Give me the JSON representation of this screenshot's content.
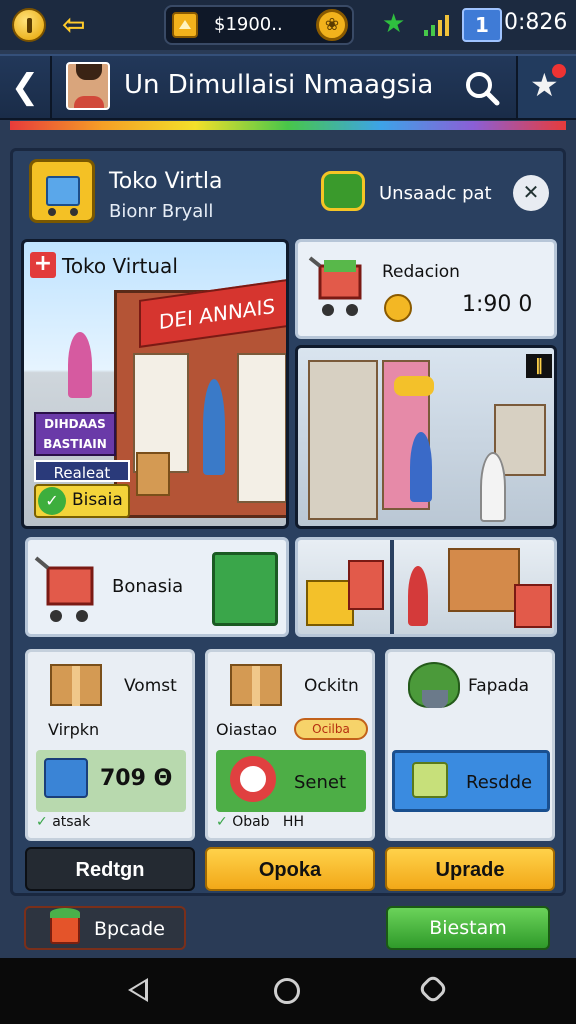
{
  "status_bar": {
    "money": "$1900..",
    "time": "0:826",
    "battery_glyph": "1"
  },
  "header": {
    "title": "Un Dimullaisi Nmaagsia"
  },
  "shop": {
    "title": "Toko Virtla",
    "subtitle": "Bionr Bryall",
    "ticket_label": "Unsaadc pat"
  },
  "scene_main": {
    "title": "Toko Virtual",
    "store_sign": "DEI ANNAIS",
    "promo_sign": "DIHDAAS BASTIAIN",
    "release_tag": "Realeat",
    "badge_label": "Bisaia"
  },
  "redacion_card": {
    "label": "Redacion",
    "price": "1:90 0"
  },
  "bonasia_card": {
    "label": "Bonasia"
  },
  "products": [
    {
      "name": "Vomst",
      "sub": "Virpkn",
      "price": "709 Θ",
      "status": "atsak",
      "button": "Redtgn"
    },
    {
      "name": "Ockitn",
      "sub": "Oiastao",
      "pill": "Ocilba",
      "panel_label": "Senet",
      "status": "Obab",
      "status_extra": "HH",
      "button": "Opoka"
    },
    {
      "name": "Fapada",
      "panel_label": "Resdde",
      "button": "Uprade"
    }
  ],
  "footer": {
    "left_label": "Bpcade",
    "right_label": "Biestam"
  },
  "colors": {
    "background": "#2a3b56",
    "accent_yellow": "#f2a818",
    "accent_green": "#2f9a2a",
    "accent_red": "#d6352f"
  }
}
